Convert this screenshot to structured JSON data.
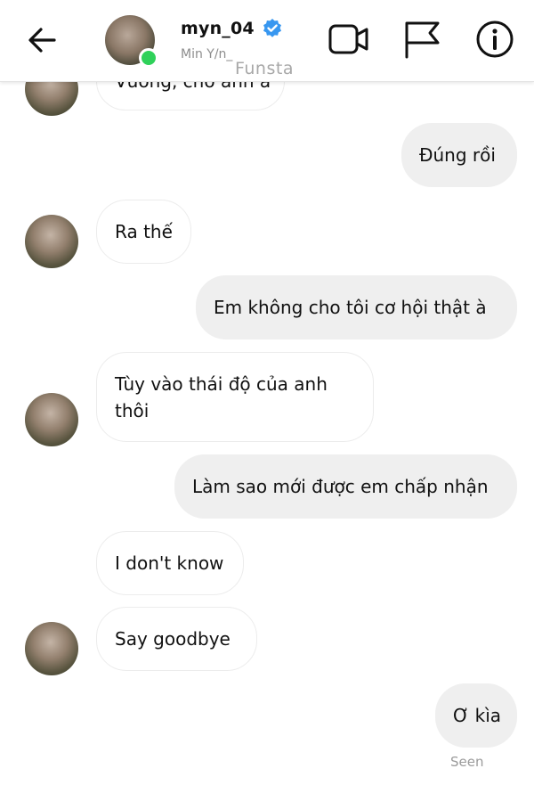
{
  "header": {
    "username": "myn_04",
    "subname": "Min Y/n_",
    "watermark": "Funsta",
    "icons": {
      "back": "arrow-left-icon",
      "verified": "verified-badge-icon",
      "video": "video-camera-icon",
      "flag": "flag-icon",
      "info": "info-icon"
    },
    "colors": {
      "online": "#2fd15a",
      "verified": "#3897f0"
    }
  },
  "messages": [
    {
      "sender": "them",
      "text": "Vương, cho anh à"
    },
    {
      "sender": "me",
      "text": "Đúng rồi"
    },
    {
      "sender": "them",
      "text": "Ra thế"
    },
    {
      "sender": "me",
      "text": "Em không cho tôi cơ hội thật à"
    },
    {
      "sender": "them",
      "text": "Tùy vào thái độ của anh thôi"
    },
    {
      "sender": "me",
      "text": "Làm sao mới được em chấp nhận"
    },
    {
      "sender": "them",
      "text": "I don't know"
    },
    {
      "sender": "them",
      "text": "Say goodbye"
    },
    {
      "sender": "me",
      "text": "Ơ kìa"
    }
  ],
  "status": {
    "seen": "Seen"
  }
}
